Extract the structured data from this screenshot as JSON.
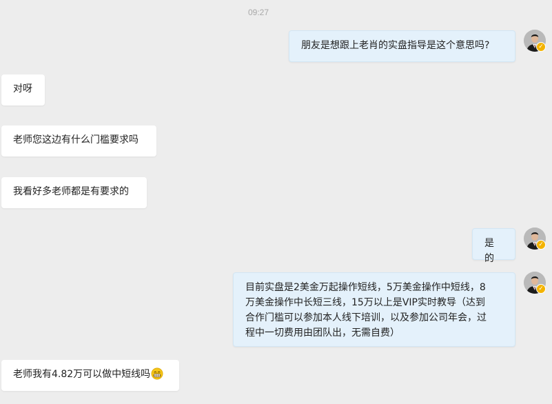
{
  "timestamp": "09:27",
  "messages": [
    {
      "side": "right",
      "text": "朋友是想跟上老肖的实盘指导是这个意思吗?"
    },
    {
      "side": "left",
      "text": "对呀"
    },
    {
      "side": "left",
      "text": "老师您这边有什么门槛要求吗"
    },
    {
      "side": "left",
      "text": "我看好多老师都是有要求的"
    },
    {
      "side": "right",
      "text": "是的"
    },
    {
      "side": "right",
      "lines": [
        "目前实盘是2美金万起操作短线，5万美金操作中短线，8",
        "万美金操作中长短三线，15万以上是VIP实时教导（达到",
        "合作门槛可以参加本人线下培训，以及参加公司年会，过",
        "程中一切费用由团队出，无需自费）"
      ]
    },
    {
      "side": "left",
      "text": "老师我有4.82万可以做中短线吗",
      "emoji": "grinning-face-emoji"
    }
  ],
  "avatar": {
    "icon": "person-in-suit-avatar",
    "badge_icon": "verified-check-icon",
    "badge_glyph": "✓",
    "badge_color": "#f3b300"
  },
  "colors": {
    "background": "#ededed",
    "received_bubble": "#ffffff",
    "sent_bubble": "#e4f1fb",
    "timestamp_text": "#a8a8a8"
  }
}
